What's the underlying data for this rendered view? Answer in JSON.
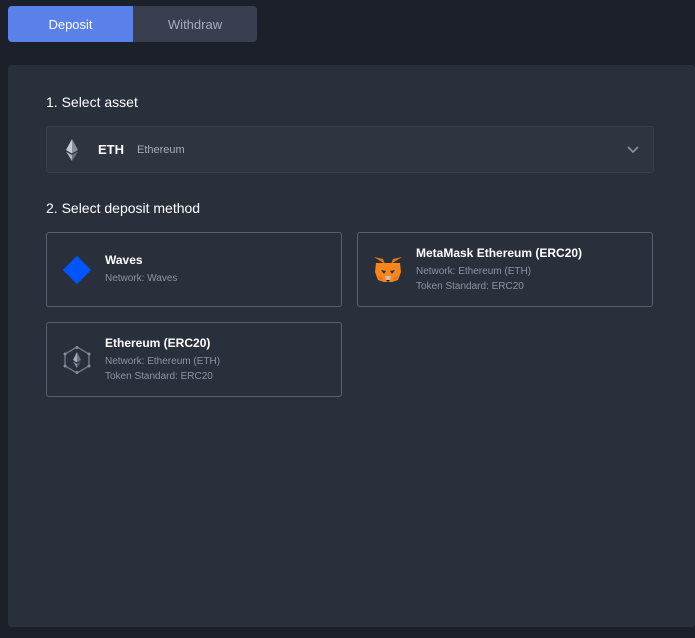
{
  "tabs": {
    "deposit_label": "Deposit",
    "withdraw_label": "Withdraw"
  },
  "sections": {
    "select_asset": "1. Select asset",
    "select_method": "2. Select deposit method"
  },
  "asset": {
    "ticker": "ETH",
    "name": "Ethereum",
    "icon": "ethereum-icon"
  },
  "methods": [
    {
      "title": "Waves",
      "network": "Network: Waves",
      "icon": "waves-icon"
    },
    {
      "title": "MetaMask Ethereum (ERC20)",
      "network": "Network: Ethereum (ETH)",
      "standard": "Token Standard: ERC20",
      "icon": "metamask-fox-icon"
    },
    {
      "title": "Ethereum (ERC20)",
      "network": "Network: Ethereum (ETH)",
      "standard": "Token Standard: ERC20",
      "icon": "ethereum-hex-icon"
    }
  ],
  "colors": {
    "accent": "#5a81ea",
    "background": "#1c202b",
    "panel": "#2a2f3c",
    "waves_blue": "#0055ff"
  }
}
